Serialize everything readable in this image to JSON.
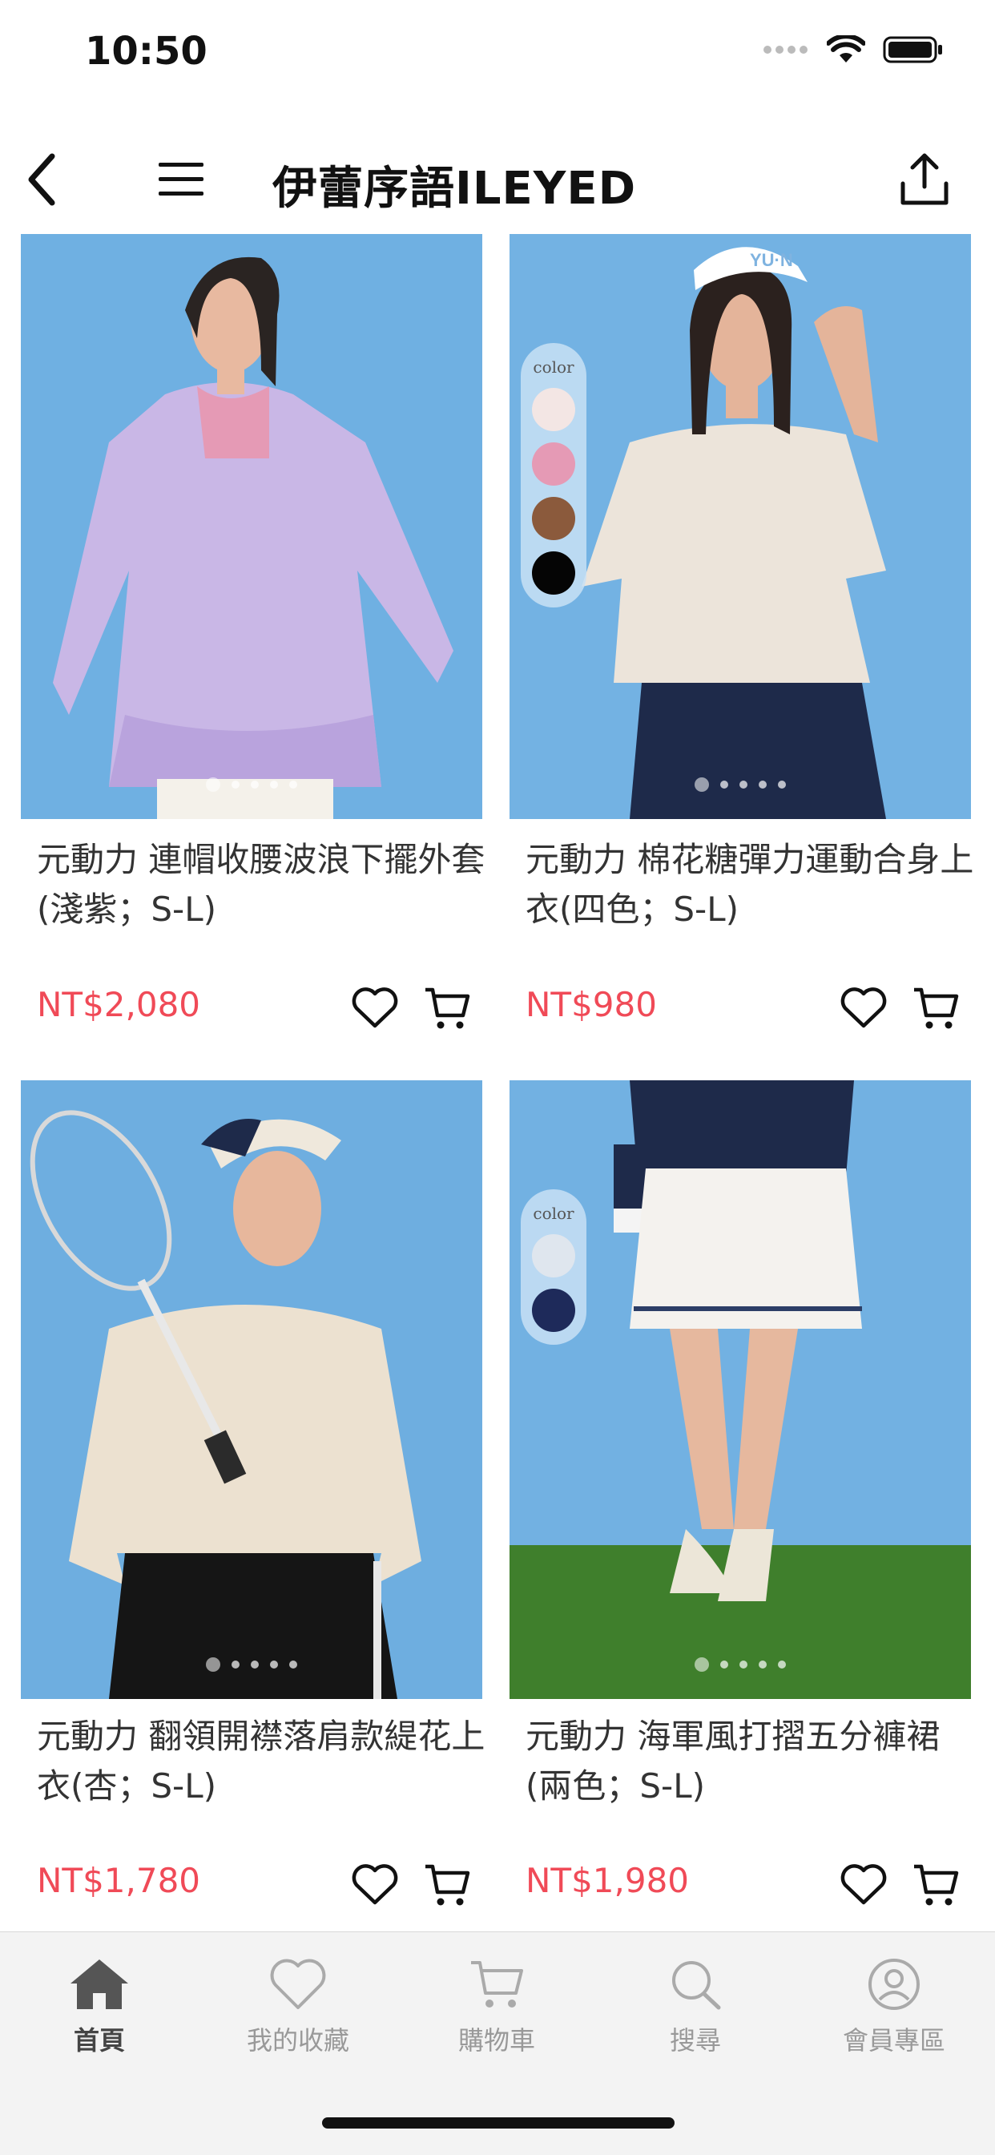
{
  "status": {
    "time": "10:50"
  },
  "nav": {
    "title": "伊蕾序語ILEYED"
  },
  "products": [
    {
      "name": "元動力 連帽收腰波浪下擺外套(淺紫；S-L)",
      "price": "NT$2,080",
      "image_pages": 5,
      "image_page": 1
    },
    {
      "name": "元動力 棉花糖彈力運動合身上衣(四色；S-L)",
      "price": "NT$980",
      "image_pages": 5,
      "image_page": 1,
      "swatch_label": "color",
      "swatches": [
        "#f3e6e4",
        "#e59ab5",
        "#8b5a3c",
        "#050505"
      ]
    },
    {
      "name": "元動力 翻領開襟落肩款緹花上衣(杏；S-L)",
      "price": "NT$1,780",
      "image_pages": 5,
      "image_page": 1
    },
    {
      "name": "元動力 海軍風打摺五分褲裙(兩色；S-L)",
      "price": "NT$1,980",
      "image_pages": 5,
      "image_page": 1,
      "swatch_label": "color",
      "swatches": [
        "#dfe6ee",
        "#1e2a5a"
      ]
    }
  ],
  "tabbar": {
    "items": [
      {
        "label": "首頁",
        "icon": "home-icon",
        "active": true
      },
      {
        "label": "我的收藏",
        "icon": "heart-icon",
        "active": false
      },
      {
        "label": "購物車",
        "icon": "cart-icon",
        "active": false
      },
      {
        "label": "搜尋",
        "icon": "search-icon",
        "active": false
      },
      {
        "label": "會員專區",
        "icon": "user-icon",
        "active": false
      }
    ]
  },
  "colors": {
    "price": "#f04a57",
    "image_bg": "#6fb0e2",
    "grass": "#3f7f2c"
  }
}
